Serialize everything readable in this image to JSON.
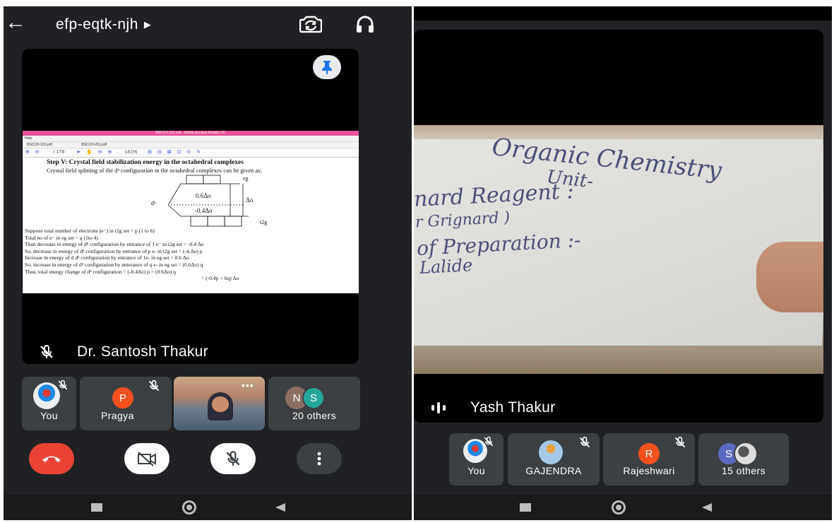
{
  "left_phone": {
    "meeting_code": "efp-eqtk-njh",
    "main_speaker": "Dr. Santosh Thakur",
    "pdf": {
      "window_title": "BSCCH-201.pdf - Adobe Acrobat Reader DC",
      "menu": "Help",
      "tab1": "BSCCH-201.pdf",
      "tab2": "BSCCH-201.pdf",
      "page_indicator": "/ 178",
      "zoom": "141%",
      "heading": "Step V: Crystal field stabilization energy in the octahedral complexes",
      "intro": "Crystal field splitting of the dⁿ configuration in the octahedral complexes can be given as:",
      "label_eg": "eg",
      "label_06": "0.6Δo",
      "label_dn": "dⁿ",
      "label_delta": "Δo",
      "label_m04": "-0.4Δo",
      "label_t2g": "t2g",
      "lines": [
        "Suppose total number of electrons (e⁻) in t2g set = p (1 to 6)",
        "Total no of e⁻ in eg set = q (1to 4)",
        "Than decrease in energy of dⁿ configuration by entrance of 1 e⁻ in t2g set = -0.4 Δo",
        "So, decrease in energy of dⁿ configuration by entrance of p e- in t2g set = (-4.Δo) p",
        "Increase in energy of d dⁿ configuration by entrance of 1e- in eg set = 0.6 Δo",
        "So, increase in energy of dⁿ configuration by enterance of q e- in eg set = (0.6Δo) q",
        "Thus, total energy change of dⁿ configuration = (-0.4Δo) p + (0.6Δo) q"
      ],
      "last_line": "= (-0.4p + 6q) Δo"
    },
    "participants": [
      {
        "label": "You"
      },
      {
        "label": "Pragya",
        "initial": "P"
      },
      {
        "label": ""
      },
      {
        "label": "20 others",
        "initial_a": "N",
        "initial_b": "S"
      }
    ],
    "more_dots": "•••",
    "colors": {
      "end_call": "#ea4335",
      "pragya": "#f4511e",
      "n": "#8d6e63",
      "s": "#26a69a"
    }
  },
  "right_phone": {
    "main_speaker": "Yash Thakur",
    "board_lines": [
      "Organic Chemistry",
      "Unit-",
      "nard Reagent :",
      "r Grignard )",
      "of Preparation :-",
      "Lalide"
    ],
    "participants": [
      {
        "label": "You"
      },
      {
        "label": "GAJENDRA"
      },
      {
        "label": "Rajeshwari",
        "initial": "R"
      },
      {
        "label": "15 others",
        "initial": "S"
      }
    ],
    "colors": {
      "rajeshwari": "#f4511e",
      "s": "#5c6bc0"
    }
  }
}
